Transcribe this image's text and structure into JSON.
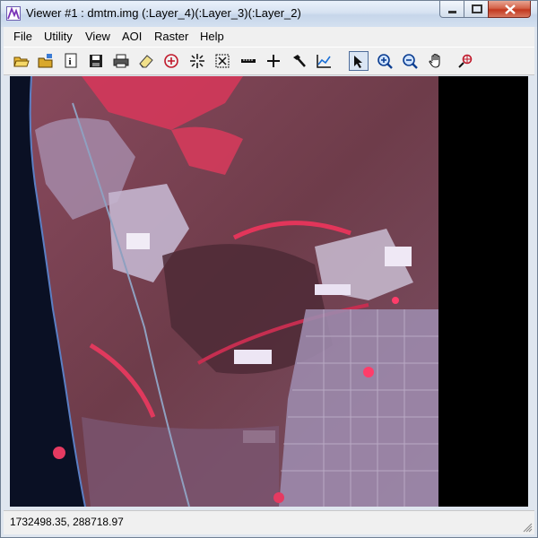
{
  "window": {
    "title": "Viewer #1 : dmtm.img (:Layer_4)(:Layer_3)(:Layer_2)"
  },
  "menu": [
    "File",
    "Utility",
    "View",
    "AOI",
    "Raster",
    "Help"
  ],
  "toolbar": [
    {
      "name": "open-folder-icon"
    },
    {
      "name": "open-layer-icon"
    },
    {
      "name": "info-icon"
    },
    {
      "name": "save-icon"
    },
    {
      "name": "print-icon"
    },
    {
      "name": "eraser-icon"
    },
    {
      "name": "link-icon"
    },
    {
      "name": "crosshair-icon"
    },
    {
      "name": "fit-icon"
    },
    {
      "name": "ruler-icon"
    },
    {
      "name": "plus-icon"
    },
    {
      "name": "hammer-icon"
    },
    {
      "name": "chart-icon"
    },
    {
      "name": "select-arrow-icon",
      "active": true
    },
    {
      "name": "zoom-in-icon"
    },
    {
      "name": "zoom-out-icon"
    },
    {
      "name": "pan-hand-icon"
    },
    {
      "name": "inquire-icon"
    }
  ],
  "status": {
    "coordinates": "1732498.35, 288718.97"
  },
  "colors": {
    "background_frame": "#000000",
    "vegetation_red": "#e23a5a",
    "urban_lavender": "#b9a6c8",
    "ocean": "#0a1024"
  }
}
